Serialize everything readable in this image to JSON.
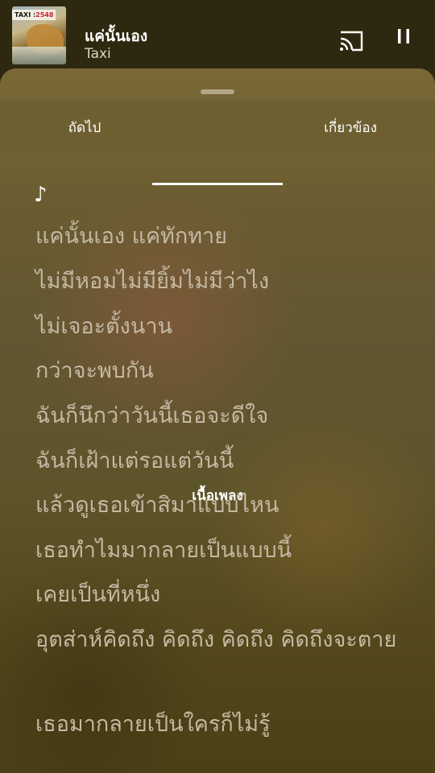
{
  "miniplayer": {
    "album_stamp_text": "TAXI",
    "album_stamp_year": "2548",
    "title": "แค่นั้นเอง",
    "artist": "Taxi"
  },
  "tabs": {
    "next": "ถัดไป",
    "lyrics": "เนื้อเพลง",
    "related": "เกี่ยวข้อง",
    "active": "lyrics"
  },
  "lyrics": {
    "note": "♪",
    "lines": [
      "แค่นั้นเอง แค่ทักทาย",
      "ไม่มีหอมไม่มียิ้มไม่มีว่าไง",
      "ไม่เจอะตั้งนาน",
      "กว่าจะพบกัน",
      "ฉันก็นึกว่าวันนี้เธอจะดีใจ",
      "ฉันก็เฝ้าแต่รอแต่วันนี้",
      "แล้วดูเธอเข้าสิมาแบบไหน",
      "เธอทำไมมากลายเป็นแบบนี้",
      "เคยเป็นที่หนึ่ง",
      "อุตส่าห์คิดถึง คิดถึง คิดถึง คิดถึงจะตาย",
      "เธอมากลายเป็นใครก็ไม่รู้"
    ]
  },
  "colors": {
    "accent_text": "#ffffff",
    "lyric_text": "#c3b9a3",
    "background": "#6a5c31"
  }
}
